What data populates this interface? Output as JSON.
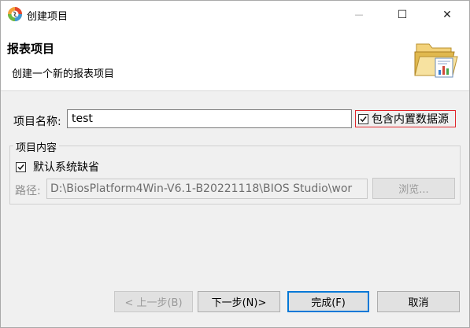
{
  "window": {
    "title": "创建项目",
    "minimize_glyph": "—",
    "maximize_glyph": "☐",
    "close_glyph": "✕"
  },
  "banner": {
    "title": "报表项目",
    "description": "创建一个新的报表项目",
    "icon": "folder-report-icon"
  },
  "form": {
    "name_label": "项目名称:",
    "name_value": "test",
    "builtin_datasource_label": "包含内置数据源",
    "builtin_datasource_checked": true,
    "group_title": "项目内容",
    "default_location_label": "默认系统缺省",
    "default_location_checked": true,
    "path_label": "路径:",
    "path_value": "D:\\BiosPlatform4Win-V6.1-B20221118\\BIOS Studio\\wor",
    "browse_label": "浏览..."
  },
  "buttons": {
    "back": "< 上一步(B)",
    "next": "下一步(N)>",
    "finish": "完成(F)",
    "cancel": "取消"
  },
  "colors": {
    "highlight_border": "#e0262b",
    "default_button_border": "#0078d7"
  }
}
